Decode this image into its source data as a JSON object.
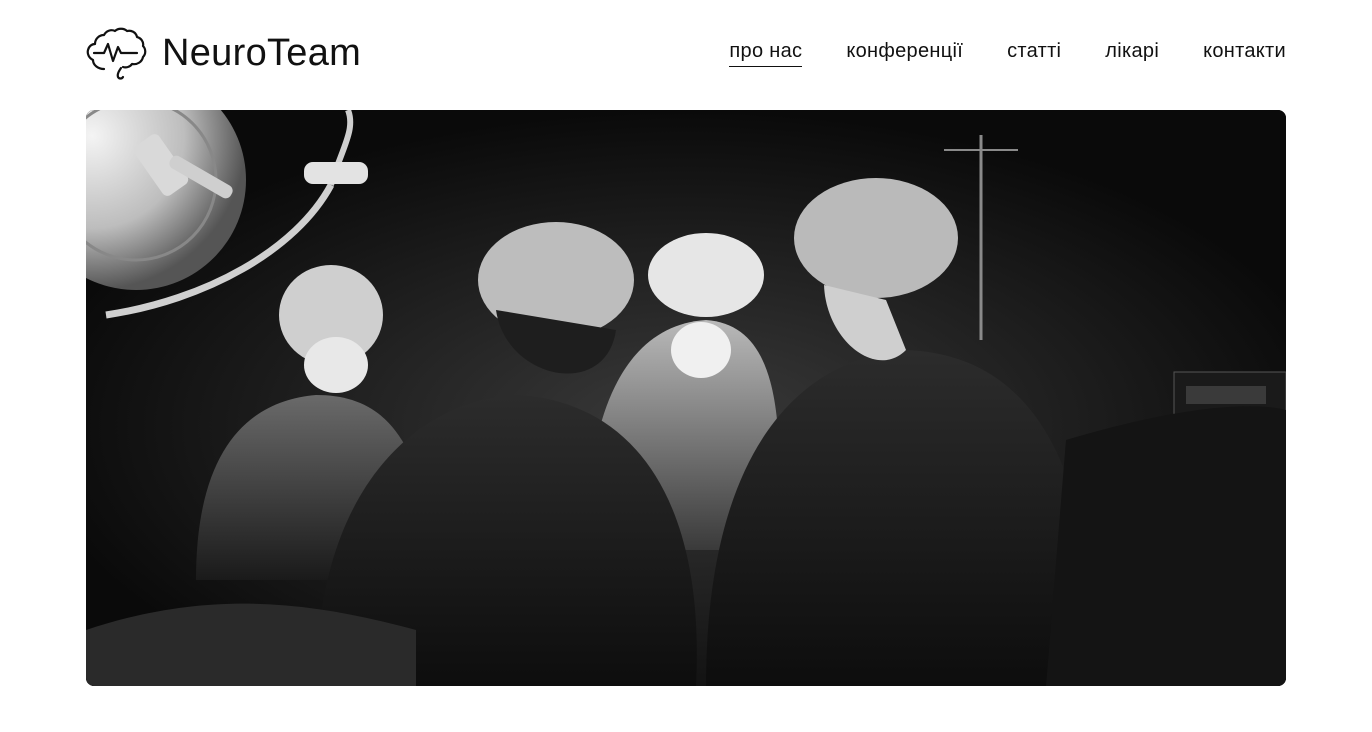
{
  "header": {
    "logo_text": "NeuroTeam",
    "logo_icon": "brain-pulse-icon"
  },
  "nav": {
    "items": [
      {
        "label": "про нас",
        "active": true
      },
      {
        "label": "конференції",
        "active": false
      },
      {
        "label": "статті",
        "active": false
      },
      {
        "label": "лікарі",
        "active": false
      },
      {
        "label": "контакти",
        "active": false
      }
    ]
  },
  "hero": {
    "image": "surgeons-operating-room-bw-photo"
  },
  "colors": {
    "background": "#ffffff",
    "text": "#111111",
    "photo_dark": "#0b0b0b"
  }
}
